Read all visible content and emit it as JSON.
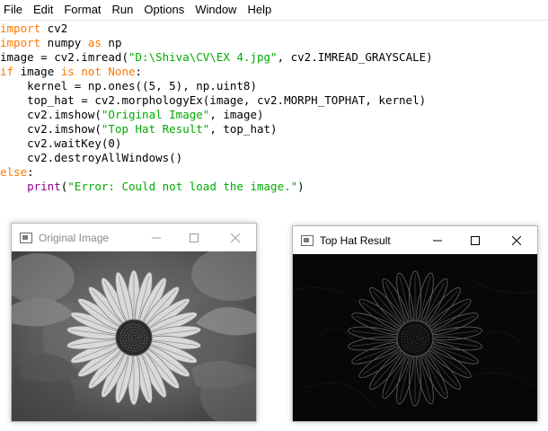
{
  "menu": [
    "File",
    "Edit",
    "Format",
    "Run",
    "Options",
    "Window",
    "Help"
  ],
  "code_lines": [
    [
      {
        "t": "import",
        "c": "kw"
      },
      {
        "t": " cv2",
        "c": ""
      }
    ],
    [
      {
        "t": "import",
        "c": "kw"
      },
      {
        "t": " numpy ",
        "c": ""
      },
      {
        "t": "as",
        "c": "kw"
      },
      {
        "t": " np",
        "c": ""
      }
    ],
    [
      {
        "t": "image = cv2.imread(",
        "c": ""
      },
      {
        "t": "\"D:\\Shiva\\CV\\EX 4.jpg\"",
        "c": "str"
      },
      {
        "t": ", cv2.IMREAD_GRAYSCALE)",
        "c": ""
      }
    ],
    [
      {
        "t": "if",
        "c": "kw"
      },
      {
        "t": " image ",
        "c": ""
      },
      {
        "t": "is not None",
        "c": "kw"
      },
      {
        "t": ":",
        "c": ""
      }
    ],
    [
      {
        "t": "    kernel = np.ones((5, 5), np.uint8)",
        "c": ""
      }
    ],
    [
      {
        "t": "    top_hat = cv2.morphologyEx(image, cv2.MORPH_TOPHAT, kernel)",
        "c": ""
      }
    ],
    [
      {
        "t": "    cv2.imshow(",
        "c": ""
      },
      {
        "t": "\"Original Image\"",
        "c": "str"
      },
      {
        "t": ", image)",
        "c": ""
      }
    ],
    [
      {
        "t": "    cv2.imshow(",
        "c": ""
      },
      {
        "t": "\"Top Hat Result\"",
        "c": "str"
      },
      {
        "t": ", top_hat)",
        "c": ""
      }
    ],
    [
      {
        "t": "    cv2.waitKey(0)",
        "c": ""
      }
    ],
    [
      {
        "t": "    cv2.destroyAllWindows()",
        "c": ""
      }
    ],
    [
      {
        "t": "else",
        "c": "kw"
      },
      {
        "t": ":",
        "c": ""
      }
    ],
    [
      {
        "t": "    ",
        "c": ""
      },
      {
        "t": "print",
        "c": "bi"
      },
      {
        "t": "(",
        "c": ""
      },
      {
        "t": "\"Error: Could not load the image.\"",
        "c": "str"
      },
      {
        "t": ")",
        "c": ""
      }
    ]
  ],
  "windows": {
    "original": {
      "title": "Original Image",
      "icon": "image-window-icon"
    },
    "tophat": {
      "title": "Top Hat Result",
      "icon": "image-window-icon"
    }
  },
  "colors": {
    "keyword": "#ff7700",
    "string": "#00aa00",
    "builtin": "#900090"
  }
}
